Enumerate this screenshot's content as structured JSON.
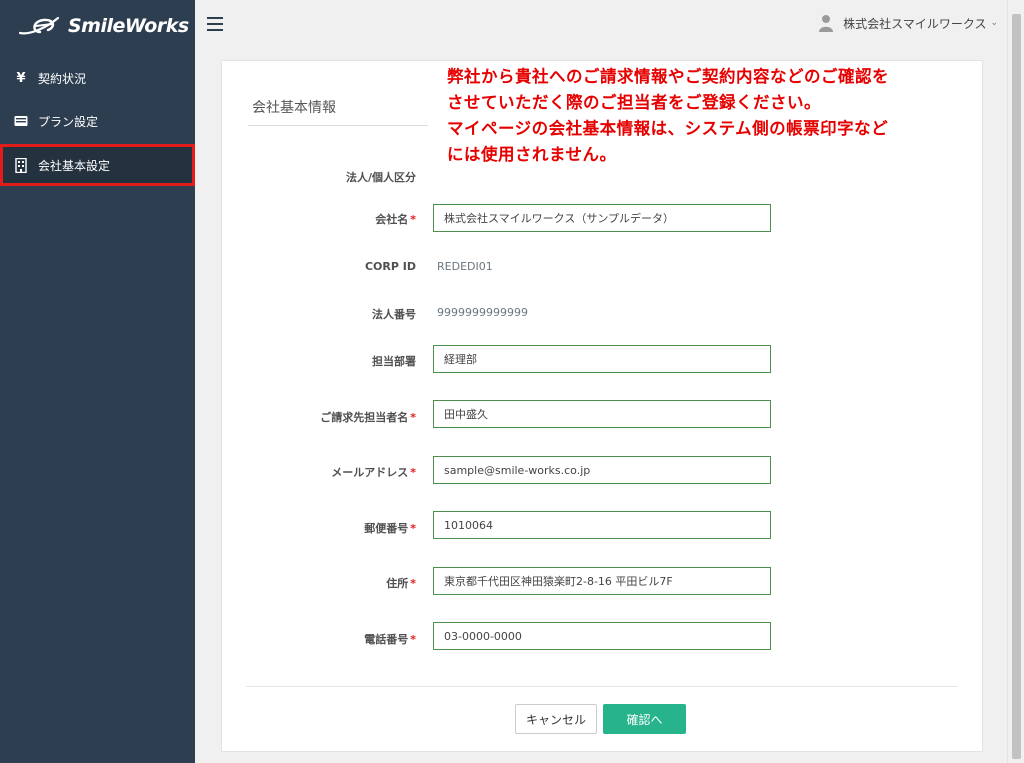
{
  "brand": {
    "name": "SmileWorks"
  },
  "sidebar": {
    "items": [
      {
        "label": "契約状況",
        "icon": "yen-icon"
      },
      {
        "label": "プラン設定",
        "icon": "card-icon"
      },
      {
        "label": "会社基本設定",
        "icon": "building-icon",
        "active": true
      }
    ]
  },
  "header": {
    "user_name": "株式会社スマイルワークス",
    "caret": "⌄"
  },
  "section": {
    "title": "会社基本情報"
  },
  "notice": {
    "lines": [
      "弊社から貴社へのご請求情報やご契約内容などのご確認を",
      "させていただく際のご担当者をご登録ください。",
      "マイページの会社基本情報は、システム側の帳票印字など",
      "には使用されません。"
    ]
  },
  "form": {
    "required_mark": "*",
    "corp_type": {
      "label": "法人/個人区分"
    },
    "company_name": {
      "label": "会社名",
      "value": "株式会社スマイルワークス（サンプルデータ）"
    },
    "corp_id": {
      "label": "CORP ID",
      "value": "REDEDI01"
    },
    "corp_number": {
      "label": "法人番号",
      "value": "9999999999999"
    },
    "department": {
      "label": "担当部署",
      "value": "経理部"
    },
    "billing_contact": {
      "label": "ご請求先担当者名",
      "value": "田中盛久"
    },
    "email": {
      "label": "メールアドレス",
      "value": "sample@smile-works.co.jp"
    },
    "postal_code": {
      "label": "郵便番号",
      "value": "1010064"
    },
    "address": {
      "label": "住所",
      "value": "東京都千代田区神田猿楽町2-8-16 平田ビル7F"
    },
    "phone": {
      "label": "電話番号",
      "value": "03-0000-0000"
    }
  },
  "buttons": {
    "cancel": "キャンセル",
    "confirm": "確認へ"
  },
  "colors": {
    "sidebar_bg": "#2d3e50",
    "accent": "#27b38c",
    "notice_red": "#e60000",
    "highlight_border": "#e21b1b",
    "field_border": "#4d8f4d"
  }
}
